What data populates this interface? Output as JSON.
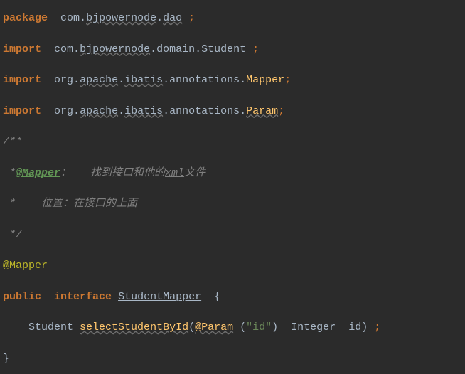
{
  "line1": {
    "package": "package",
    "pkg1": "com",
    "pkg2": "bjpowernode",
    "pkg3": "dao"
  },
  "line2": {
    "import": "import",
    "p1": "com",
    "p2": "bjpowernode",
    "p3": "domain",
    "p4": "Student"
  },
  "line3": {
    "import": "import",
    "p1": "org",
    "p2": "apache",
    "p3": "ibatis",
    "p4": "annotations",
    "p5": "Mapper"
  },
  "line4": {
    "import": "import",
    "p1": "org",
    "p2": "apache",
    "p3": "ibatis",
    "p4": "annotations",
    "p5": "Param"
  },
  "comment": {
    "l1": "/**",
    "l2a": " *",
    "l2tag": "@Mapper",
    "l2b": "：   找到接口和他的",
    "l2xml": "xml",
    "l2c": "文件",
    "l3": " *    位置：在接口的上面",
    "l4": " */"
  },
  "annotation": {
    "mapper": "@Mapper"
  },
  "decl": {
    "public": "public",
    "interface": "interface",
    "name": "StudentMapper",
    "brace": "{"
  },
  "method": {
    "return": "Student",
    "name": "selectStudentById",
    "anno": "@Param",
    "str": "\"id\"",
    "type": "Integer",
    "param": "id"
  },
  "close": "}"
}
